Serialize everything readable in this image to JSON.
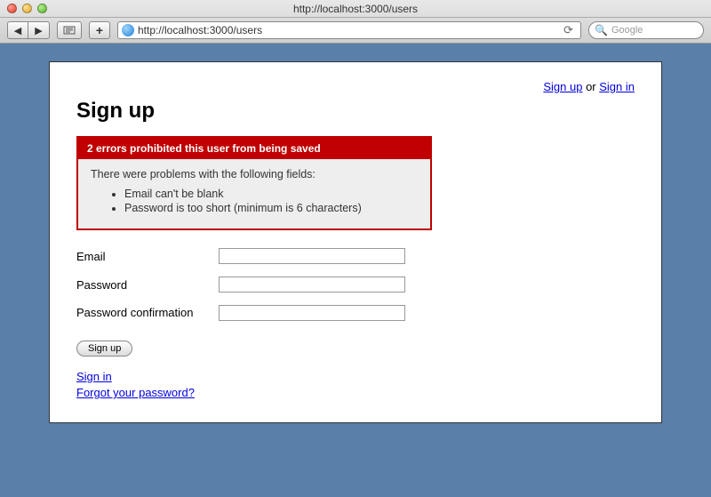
{
  "window": {
    "title": "http://localhost:3000/users",
    "url": "http://localhost:3000/users",
    "search_placeholder": "Google"
  },
  "top_nav": {
    "signup": "Sign up",
    "or": " or ",
    "signin": "Sign in"
  },
  "page": {
    "heading": "Sign up"
  },
  "errors": {
    "header": "2 errors prohibited this user from being saved",
    "intro": "There were problems with the following fields:",
    "items": [
      "Email can't be blank",
      "Password is too short (minimum is 6 characters)"
    ]
  },
  "form": {
    "email_label": "Email",
    "password_label": "Password",
    "password_confirmation_label": "Password confirmation",
    "submit": "Sign up"
  },
  "links": {
    "signin": "Sign in",
    "forgot": "Forgot your password?"
  }
}
